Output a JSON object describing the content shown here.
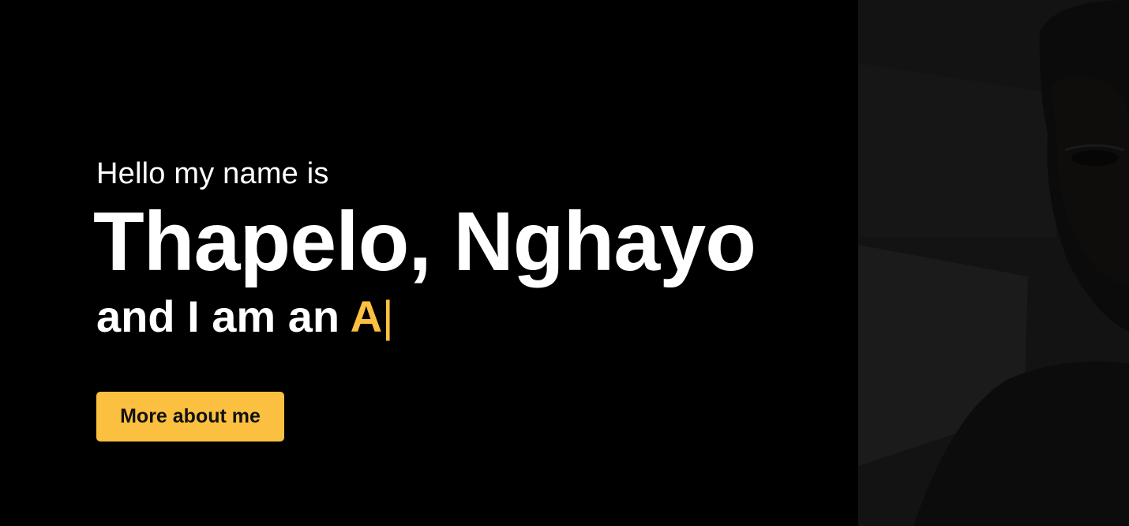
{
  "hero": {
    "greeting": "Hello my name is",
    "name": "Thapelo, Nghayo",
    "role_prefix": "and I am an ",
    "role_typed": "A",
    "cursor": "|",
    "cta_label": "More about me"
  },
  "colors": {
    "background": "#000000",
    "text": "#ffffff",
    "accent": "#fcc041"
  },
  "media": {
    "portrait": "portrait-photo"
  }
}
